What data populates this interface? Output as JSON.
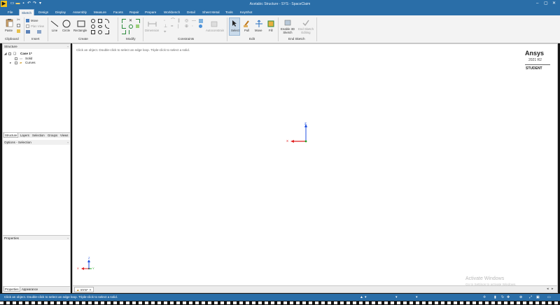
{
  "title_bar": {
    "title": "Acetabic Structure - SYS - SpaceClaim",
    "window_controls": [
      "–",
      "▢",
      "✕"
    ]
  },
  "menu": {
    "tabs": [
      "File",
      "Sketch",
      "Design",
      "Display",
      "Assembly",
      "Measure",
      "Facets",
      "Repair",
      "Prepare",
      "Workbench",
      "Detail",
      "Sheet Metal",
      "Tools",
      "KeyShot"
    ],
    "active": "Sketch"
  },
  "ribbon": {
    "clipboard": {
      "label": "Clipboard",
      "paste": "Paste"
    },
    "insert": {
      "label": "Insert",
      "move": "Move",
      "plan_view": "Plan View"
    },
    "create": {
      "label": "Create",
      "line": "Line",
      "circle": "Circle",
      "rectangle": "Rectangle"
    },
    "modify": {
      "label": "Modify"
    },
    "constraints": {
      "label": "Constraints",
      "dimension": "Dimension",
      "autoconstrain": "Autoconstrain"
    },
    "edit": {
      "label": "Edit",
      "select": "Select",
      "pull": "Pull",
      "move": "Move",
      "fill": "Fill"
    },
    "end_sketch": {
      "label": "End Sketch",
      "enable_3d": "Enable 3D Sketch",
      "end_editing": "End Sketch Editing"
    }
  },
  "structure_panel": {
    "header": "Structure",
    "tree": [
      {
        "label": "Case 1*"
      },
      {
        "label": "Solid"
      },
      {
        "label": "Curves"
      }
    ],
    "tabs": [
      "Structure",
      "Layers",
      "Selection",
      "Groups",
      "Views"
    ]
  },
  "options_panel": {
    "header": "Options - Selection"
  },
  "properties_panel": {
    "header": "Properties",
    "tabs": [
      "Properties",
      "Appearance"
    ]
  },
  "viewport": {
    "hint": "Click an object. Double-click to select an edge loop. Triple-click to select a solid.",
    "logo": {
      "brand": "Ansys",
      "version": "2021 R2",
      "edition": "STUDENT"
    },
    "activate": {
      "title": "Activate Windows",
      "subtitle": "Go to Settings to activate Windows."
    },
    "axes": {
      "z": "Z",
      "x": "X",
      "y": "Y"
    },
    "doc_tab": "SYS*"
  },
  "status_bar": {
    "message": "Click an object. Double-click to select an edge loop. Triple-click to select a solid."
  },
  "colors": {
    "title_blue": "#2a6ea8",
    "axis_x": "#e02020",
    "axis_z": "#2050e0",
    "axis_y": "#20a020"
  }
}
